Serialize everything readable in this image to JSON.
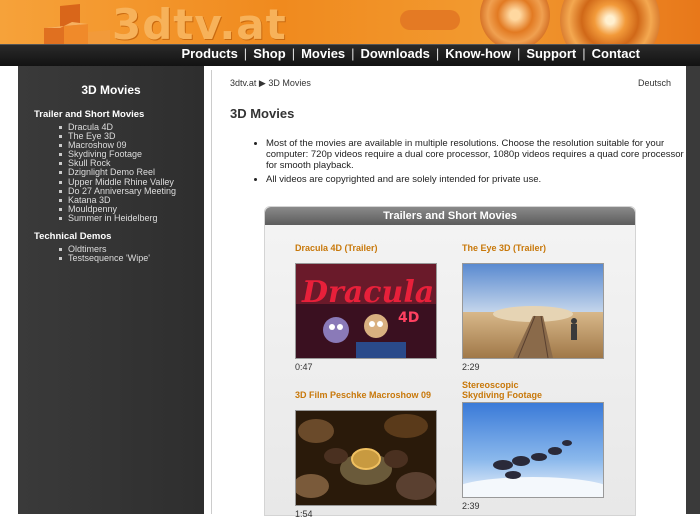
{
  "logo": {
    "text": "3dtv.at"
  },
  "nav": {
    "items": [
      "Products",
      "Shop",
      "Movies",
      "Downloads",
      "Know-how",
      "Support",
      "Contact"
    ]
  },
  "sidebar": {
    "title": "3D Movies",
    "sections": [
      {
        "heading": "Trailer and Short Movies",
        "items": [
          "Dracula 4D",
          "The Eye 3D",
          "Macroshow 09",
          "Skydiving Footage",
          "Skull Rock",
          "Dzignlight Demo Reel",
          "Upper Middle Rhine Valley",
          "Do 27 Anniversary Meeting",
          "Katana 3D",
          "Mouldpenny",
          "Summer in Heidelberg"
        ]
      },
      {
        "heading": "Technical Demos",
        "items": [
          "Oldtimers",
          "Testsequence 'Wipe'"
        ]
      }
    ]
  },
  "breadcrumb": {
    "home": "3dtv.at",
    "sep": "▶",
    "current": "3D Movies"
  },
  "lang": "Deutsch",
  "page_title": "3D Movies",
  "bullets": [
    "Most of the movies are available in multiple resolutions. Choose the resolution suitable for your computer: 720p videos require a dual core processor, 1080p videos requires a quad core processor for smooth playback.",
    "All videos are copyrighted and are solely intended for private use."
  ],
  "panel": {
    "title": "Trailers and Short Movies",
    "videos": [
      {
        "title": "Dracula 4D (Trailer)",
        "duration": "0:47"
      },
      {
        "title": "The Eye 3D (Trailer)",
        "duration": "2:29"
      },
      {
        "title": "3D Film Peschke Macroshow 09",
        "duration": "1:54"
      },
      {
        "title": "Stereoscopic Skydiving Footage",
        "duration": "2:39"
      }
    ]
  }
}
